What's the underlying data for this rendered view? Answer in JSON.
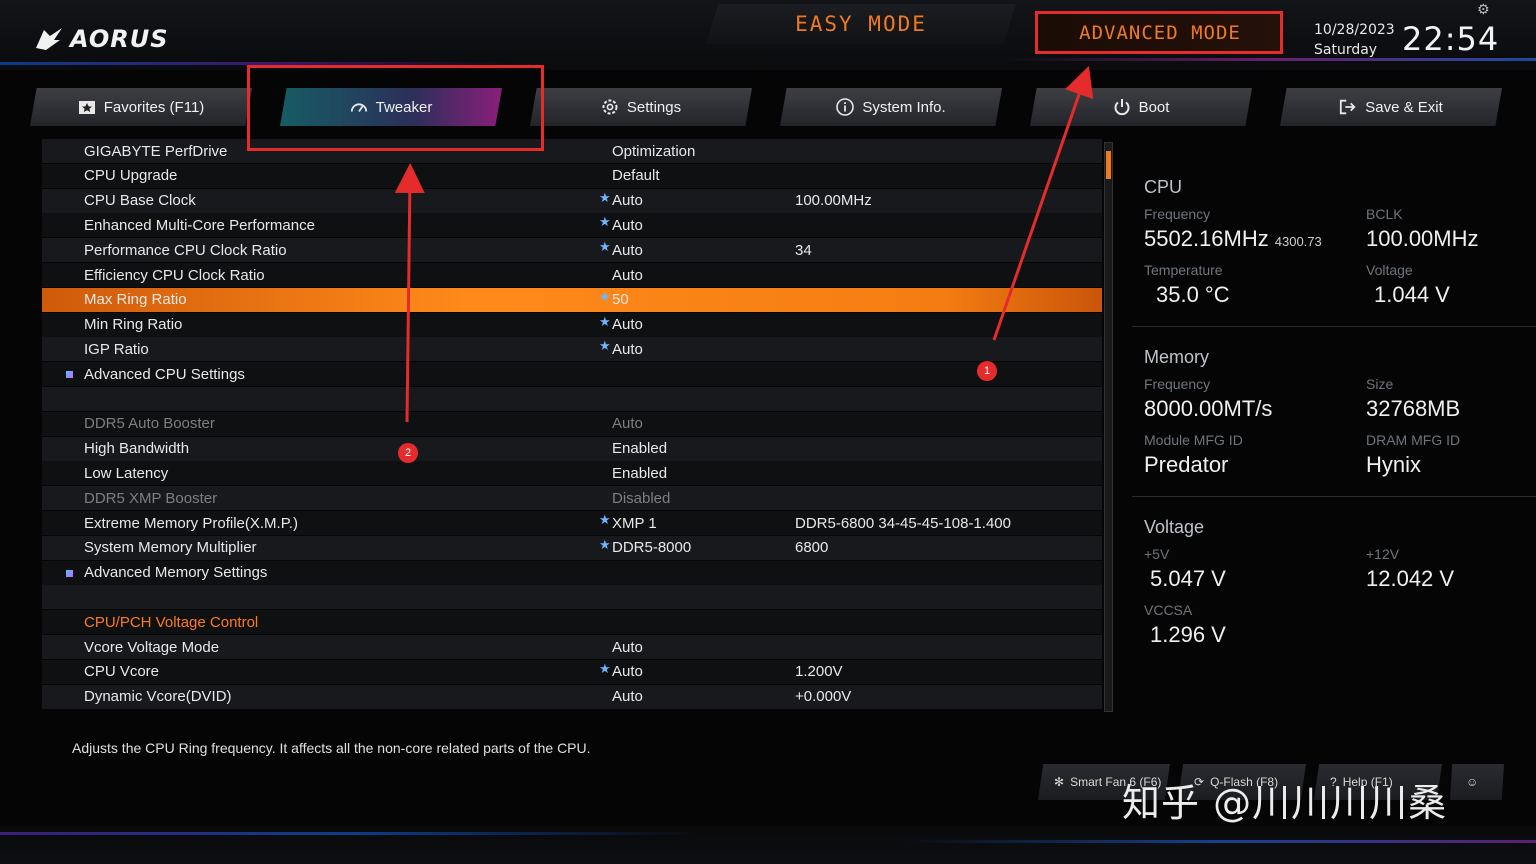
{
  "header": {
    "logo_text": "AORUS",
    "easy_mode": "EASY MODE",
    "advanced_mode": "ADVANCED MODE",
    "date": "10/28/2023",
    "weekday": "Saturday",
    "time": "22:54"
  },
  "tabs": [
    {
      "label": "Favorites (F11)",
      "icon": "star-icon"
    },
    {
      "label": "Tweaker",
      "icon": "gauge-icon",
      "active": true
    },
    {
      "label": "Settings",
      "icon": "gear-icon"
    },
    {
      "label": "System Info.",
      "icon": "info-icon"
    },
    {
      "label": "Boot",
      "icon": "power-icon"
    },
    {
      "label": "Save & Exit",
      "icon": "exit-icon"
    }
  ],
  "settings": [
    {
      "label": "GIGABYTE PerfDrive",
      "value": "Optimization",
      "value2": ""
    },
    {
      "label": "CPU Upgrade",
      "value": "Default",
      "value2": ""
    },
    {
      "label": "CPU Base Clock",
      "value": "Auto",
      "value2": "100.00MHz",
      "star": true
    },
    {
      "label": "Enhanced Multi-Core Performance",
      "value": "Auto",
      "value2": "",
      "star": true
    },
    {
      "label": "Performance CPU Clock Ratio",
      "value": "Auto",
      "value2": "34",
      "star": true
    },
    {
      "label": "Efficiency CPU Clock Ratio",
      "value": "Auto",
      "value2": ""
    },
    {
      "label": "Max Ring Ratio",
      "value": "50",
      "value2": "",
      "star": true,
      "selected": true
    },
    {
      "label": "Min Ring Ratio",
      "value": "Auto",
      "value2": "",
      "star": true
    },
    {
      "label": "IGP Ratio",
      "value": "Auto",
      "value2": "",
      "star": true
    },
    {
      "label": "Advanced CPU Settings",
      "value": "",
      "value2": "",
      "submenu": true
    },
    {
      "label": "",
      "value": "",
      "value2": ""
    },
    {
      "label": "DDR5 Auto Booster",
      "value": "Auto",
      "value2": "",
      "dim": true
    },
    {
      "label": "High Bandwidth",
      "value": "Enabled",
      "value2": ""
    },
    {
      "label": "Low Latency",
      "value": "Enabled",
      "value2": ""
    },
    {
      "label": "DDR5 XMP Booster",
      "value": "Disabled",
      "value2": "",
      "dim": true
    },
    {
      "label": "Extreme Memory Profile(X.M.P.)",
      "value": "XMP 1",
      "value2": "DDR5-6800 34-45-45-108-1.400",
      "star": true
    },
    {
      "label": "System Memory Multiplier",
      "value": "DDR5-8000",
      "value2": "6800",
      "star": true
    },
    {
      "label": "Advanced Memory Settings",
      "value": "",
      "value2": "",
      "submenu": true
    },
    {
      "label": "",
      "value": "",
      "value2": ""
    },
    {
      "label": "CPU/PCH Voltage Control",
      "value": "",
      "value2": "",
      "section": true
    },
    {
      "label": "Vcore Voltage Mode",
      "value": "Auto",
      "value2": ""
    },
    {
      "label": "CPU Vcore",
      "value": "Auto",
      "value2": "1.200V",
      "star": true
    },
    {
      "label": "Dynamic Vcore(DVID)",
      "value": "Auto",
      "value2": "+0.000V"
    }
  ],
  "info": {
    "cpu": {
      "title": "CPU",
      "frequency_label": "Frequency",
      "frequency": "5502.16MHz",
      "frequency_sub": "4300.73",
      "bclk_label": "BCLK",
      "bclk": "100.00MHz",
      "temp_label": "Temperature",
      "temp": "35.0 °C",
      "voltage_label": "Voltage",
      "voltage": "1.044 V"
    },
    "memory": {
      "title": "Memory",
      "frequency_label": "Frequency",
      "frequency": "8000.00MT/s",
      "size_label": "Size",
      "size": "32768MB",
      "module_label": "Module MFG ID",
      "module": "Predator",
      "dram_label": "DRAM MFG ID",
      "dram": "Hynix"
    },
    "voltage": {
      "title": "Voltage",
      "p5v_label": "+5V",
      "p5v": "5.047 V",
      "p12v_label": "+12V",
      "p12v": "12.042 V",
      "vccsa_label": "VCCSA",
      "vccsa": "1.296 V"
    }
  },
  "footer": {
    "help": "Adjusts the CPU Ring frequency. It affects all the non-core related parts of the CPU.",
    "buttons": [
      "Smart Fan 6 (F6)",
      "Q-Flash (F8)",
      "Help (F1)"
    ],
    "watermark": "知乎 @川川川川桑"
  },
  "annotations": [
    "1",
    "2"
  ],
  "colors": {
    "accent": "#f07a20",
    "annotation": "#e52b2b",
    "selected_row": "#ff8a1a"
  }
}
